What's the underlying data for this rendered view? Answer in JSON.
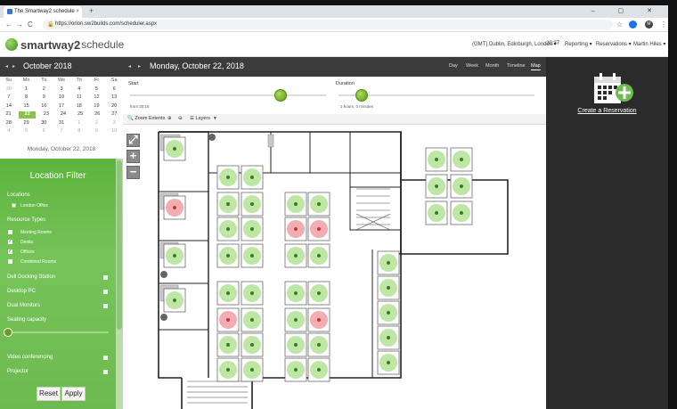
{
  "browser": {
    "tab_title": "The Smartway2 schedule",
    "tab_close": "×",
    "new_tab": "+",
    "window_controls": "– ▢ ✕",
    "url": "https://orion.sw2builds.com/scheduler.aspx",
    "nav": {
      "back": "←",
      "forward": "→",
      "reload": "C"
    },
    "bookmark_star": "☆",
    "ext_badge": "M"
  },
  "header": {
    "logo_main": "smartway2",
    "logo_sub": "schedule",
    "timezone": "(GMT) Dublin, Edinburgh, London ▾",
    "time": "20:37",
    "reporting": "Reporting ▾",
    "reservations": "Reservations ▾",
    "user": "Martin Hiles ▾"
  },
  "calendar": {
    "prev": "◂",
    "next": "▸",
    "month": "October 2018",
    "weekdays": [
      "Su",
      "Mo",
      "Tu",
      "We",
      "Th",
      "Fr",
      "Sa"
    ],
    "weeks": [
      [
        "30",
        "1",
        "2",
        "3",
        "4",
        "5",
        "6"
      ],
      [
        "7",
        "8",
        "9",
        "10",
        "11",
        "12",
        "13"
      ],
      [
        "14",
        "15",
        "16",
        "17",
        "18",
        "19",
        "20"
      ],
      [
        "21",
        "22",
        "23",
        "24",
        "25",
        "26",
        "27"
      ],
      [
        "28",
        "29",
        "30",
        "31",
        "1",
        "2",
        "3"
      ],
      [
        "4",
        "5",
        "6",
        "7",
        "8",
        "9",
        "10"
      ]
    ],
    "selected": "22",
    "selected_date_label": "Monday, October 22, 2018"
  },
  "filter": {
    "title": "Location Filter",
    "locations_label": "Locations",
    "location_item": "London Office",
    "resource_types_label": "Resource Types",
    "resource_types": [
      {
        "label": "Meeting Rooms",
        "checked": false
      },
      {
        "label": "Desks",
        "checked": true
      },
      {
        "label": "Offices",
        "checked": true
      },
      {
        "label": "Combined Rooms",
        "checked": false
      }
    ],
    "features": [
      "Dell Docking Station",
      "Desktop PC",
      "Dual Monitors"
    ],
    "seating_label": "Seating capacity",
    "features2": [
      "Video conferencing",
      "Projector"
    ],
    "reset": "Reset",
    "apply": "Apply"
  },
  "view": {
    "prev": "◂",
    "next": "▸",
    "date": "Monday, October 22, 2018",
    "tabs": [
      "Day",
      "Week",
      "Month",
      "Timeline",
      "Map"
    ],
    "active_tab": "Map",
    "start_label": "Start",
    "start_value": "from 20:15",
    "duration_label": "Duration",
    "duration_value": "1 hours, 0 minutes",
    "zoom_extents": "Zoom Extents",
    "layers": "Layers",
    "zoom_in": "+",
    "zoom_out": "−",
    "fullscreen": "⤢"
  },
  "right": {
    "create_label": "Create a Reservation"
  },
  "colors": {
    "accent": "#6dbb4e",
    "desk_free": "#b7e39a",
    "desk_busy": "#f2a3a8",
    "dark_panel": "#2b2b2b"
  }
}
